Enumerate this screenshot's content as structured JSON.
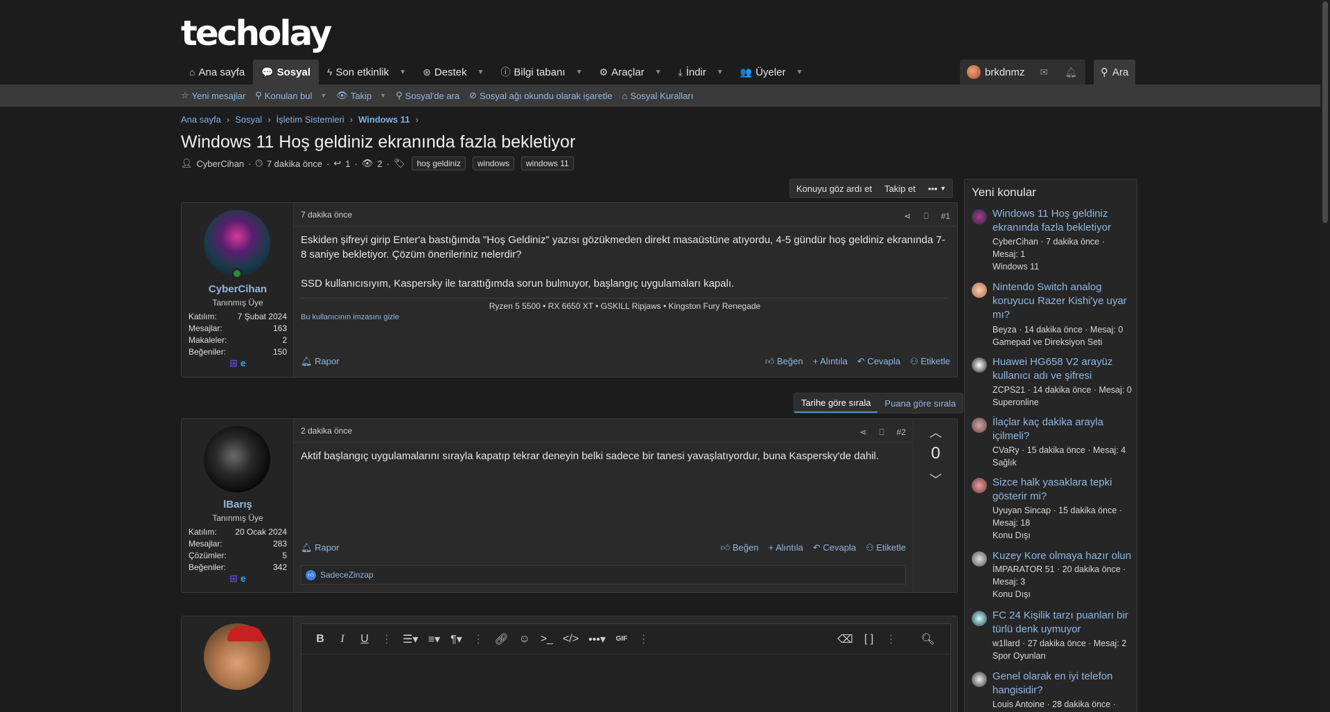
{
  "brand": {
    "logo": "techolay"
  },
  "nav": {
    "tabs": [
      {
        "label": "Ana sayfa",
        "icon": "home-icon"
      },
      {
        "label": "Sosyal",
        "icon": "chat-icon"
      },
      {
        "label": "Son etkinlik",
        "icon": "bolt-icon"
      },
      {
        "label": "Destek",
        "icon": "lifebuoy-icon"
      },
      {
        "label": "Bilgi tabanı",
        "icon": "info-icon"
      },
      {
        "label": "Araçlar",
        "icon": "gear-icon"
      },
      {
        "label": "İndir",
        "icon": "download-icon"
      },
      {
        "label": "Üyeler",
        "icon": "users-icon"
      }
    ],
    "user": {
      "username": "brkdnmz"
    },
    "search_label": "Ara"
  },
  "subnav": {
    "items": [
      "Yeni mesajlar",
      "Konulan bul",
      "Takip",
      "Sosyal'de ara",
      "Sosyal ağı okundu olarak işaretle",
      "Sosyal Kuralları"
    ]
  },
  "breadcrumb": [
    "Ana sayfa",
    "Sosyal",
    "İşletim Sistemleri",
    "Windows 11"
  ],
  "thread": {
    "title": "Windows 11 Hoş geldiniz ekranında fazla bekletiyor",
    "author": "CyberCihan",
    "time": "7 dakika önce",
    "replies": "1",
    "views": "2",
    "tags": [
      "hoş geldiniz",
      "windows",
      "windows 11"
    ],
    "actions": {
      "ignore": "Konuyu göz ardı et",
      "follow": "Takip et",
      "more": "•••"
    }
  },
  "posts": [
    {
      "username": "CyberCihan",
      "usertitle": "Tanınmış Üye",
      "stats": [
        {
          "label": "Katılım:",
          "value": "7 Şubat 2024"
        },
        {
          "label": "Mesajlar:",
          "value": "163"
        },
        {
          "label": "Makaleler:",
          "value": "2"
        },
        {
          "label": "Beğeniler:",
          "value": "150"
        }
      ],
      "time": "7 dakika önce",
      "number": "#1",
      "paragraphs": [
        "Eskiden şifreyi girip Enter'a bastığımda \"Hoş Geldiniz\" yazısı gözükmeden direkt masaüstüne atıyordu, 4-5 gündür hoş geldiniz ekranında 7-8 saniye bekletiyor. Çözüm önerileriniz nelerdir?",
        "SSD kullanıcısıyım, Kaspersky ile tarattığımda sorun bulmuyor, başlangıç uygulamaları kapalı."
      ],
      "signature": "Ryzen 5 5500 • RX 6650 XT • GSKILL Ripjaws • Kingston Fury Renegade",
      "signature_hide": "Bu kullanıcının imzasını gizle",
      "report": "Rapor",
      "actions": [
        "Beğen",
        "Alıntıla",
        "Cevapla",
        "Etiketle"
      ]
    },
    {
      "username": "lBarış",
      "usertitle": "Tanınmış Üye",
      "stats": [
        {
          "label": "Katılım:",
          "value": "20 Ocak 2024"
        },
        {
          "label": "Mesajlar:",
          "value": "283"
        },
        {
          "label": "Çözümler:",
          "value": "5"
        },
        {
          "label": "Beğeniler:",
          "value": "342"
        }
      ],
      "time": "2 dakika önce",
      "number": "#2",
      "paragraphs": [
        "Aktif başlangıç uygulamalarını sırayla kapatıp tekrar deneyin belki sadece bir tanesi yavaşlatıyordur, buna Kaspersky'de dahil."
      ],
      "score": "0",
      "report": "Rapor",
      "actions": [
        "Beğen",
        "Alıntıla",
        "Cevapla",
        "Etiketle"
      ],
      "reaction_user": "SadeceZinzap"
    }
  ],
  "sort": {
    "by_date": "Tarihe göre sırala",
    "by_score": "Puana göre sırala"
  },
  "sidebar": {
    "title": "Yeni konular",
    "items": [
      {
        "title": "Windows 11 Hoş geldiniz ekranında fazla bekletiyor",
        "meta1": "CyberCihan · 7 dakika önce ·",
        "meta2": "Mesaj: 1",
        "forum": "Windows 11"
      },
      {
        "title": "Nintendo Switch analog koruyucu Razer Kishi'ye uyar mı?",
        "meta1": "Beyza · 14 dakika önce · Mesaj: 0",
        "meta2": "",
        "forum": "Gamepad ve Direksiyon Seti"
      },
      {
        "title": "Huawei HG658 V2 arayüz kullanıcı adı ve şifresi",
        "meta1": "ZCPS21 · 14 dakika önce · Mesaj: 0",
        "meta2": "",
        "forum": "Superonline"
      },
      {
        "title": "İlaçlar kaç dakika arayla içilmeli?",
        "meta1": "CVaRy · 15 dakika önce · Mesaj: 4",
        "meta2": "",
        "forum": "Sağlık"
      },
      {
        "title": "Sizce halk yasaklara tepki gösterir mi?",
        "meta1": "Uyuyan Sincap · 15 dakika önce ·",
        "meta2": "Mesaj: 18",
        "forum": "Konu Dışı"
      },
      {
        "title": "Kuzey Kore olmaya hazır olun",
        "meta1": "İMPARATOR 51 · 20 dakika önce ·",
        "meta2": "Mesaj: 3",
        "forum": "Konu Dışı"
      },
      {
        "title": "FC 24 Kişilik tarzı puanları bir türlü denk uymuyor",
        "meta1": "w1llard · 27 dakika önce · Mesaj: 2",
        "meta2": "",
        "forum": "Spor Oyunları"
      },
      {
        "title": "Genel olarak en iyi telefon hangisidir?",
        "meta1": "Louis Antoine · 28 dakika önce ·",
        "meta2": "",
        "forum": ""
      }
    ]
  },
  "colors": {
    "accent": "#8fb8e3",
    "bg": "#1c1c1c",
    "panel": "#2a2a2a"
  }
}
